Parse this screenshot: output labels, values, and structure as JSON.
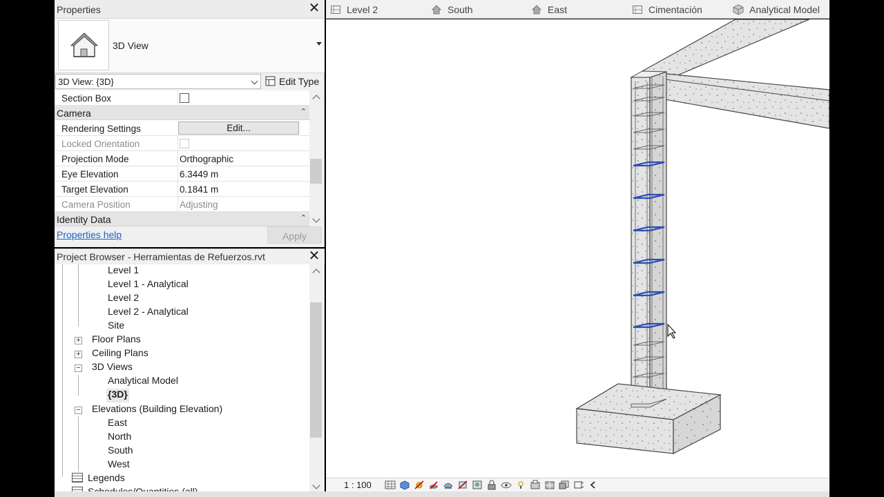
{
  "properties": {
    "title": "Properties",
    "type_name": "3D View",
    "view_selector": "3D View: {3D}",
    "edit_type_label": "Edit Type",
    "rows": {
      "section_box": "Section Box",
      "camera_header": "Camera",
      "rendering_settings": "Rendering Settings",
      "rendering_settings_button": "Edit...",
      "locked_orientation": "Locked Orientation",
      "projection_mode": "Projection Mode",
      "projection_mode_value": "Orthographic",
      "eye_elevation": "Eye Elevation",
      "eye_elevation_value": "6.3449 m",
      "target_elevation": "Target Elevation",
      "target_elevation_value": "0.1841 m",
      "camera_position": "Camera Position",
      "camera_position_value": "Adjusting",
      "identity_header": "Identity Data"
    },
    "help_link": "Properties help",
    "apply_label": "Apply"
  },
  "browser": {
    "title": "Project Browser - Herramientas de Refuerzos.rvt",
    "items": {
      "level1": "Level 1",
      "level1_analytical": "Level 1 - Analytical",
      "level2": "Level 2",
      "level2_analytical": "Level 2 - Analytical",
      "site": "Site",
      "floor_plans": "Floor Plans",
      "ceiling_plans": "Ceiling Plans",
      "views_3d": "3D Views",
      "analytical_model": "Analytical Model",
      "view_3d": "{3D}",
      "elevations": "Elevations (Building Elevation)",
      "east": "East",
      "north": "North",
      "south": "South",
      "west": "West",
      "legends": "Legends",
      "schedules": "Schedules/Quantities (all)"
    }
  },
  "tabs": [
    "Level 2",
    "South",
    "East",
    "Cimentación",
    "Analytical Model"
  ],
  "status": {
    "scale": "1 : 100"
  },
  "colors": {
    "rebar_stirrup": "#2f4fb0",
    "link": "#1a63c8",
    "concrete_face": "#e3e3e3"
  }
}
